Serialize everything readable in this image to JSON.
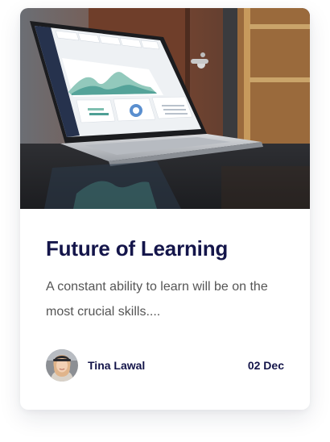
{
  "card": {
    "title": "Future of Learning",
    "excerpt": "A constant ability to learn will be on the most crucial skills....",
    "author": {
      "name": "Tina Lawal",
      "avatar_icon": "user-avatar"
    },
    "date": "02 Dec",
    "image_icon": "laptop-dashboard-photo"
  },
  "colors": {
    "heading": "#14154a",
    "body_text": "#555555",
    "card_background": "#ffffff"
  }
}
